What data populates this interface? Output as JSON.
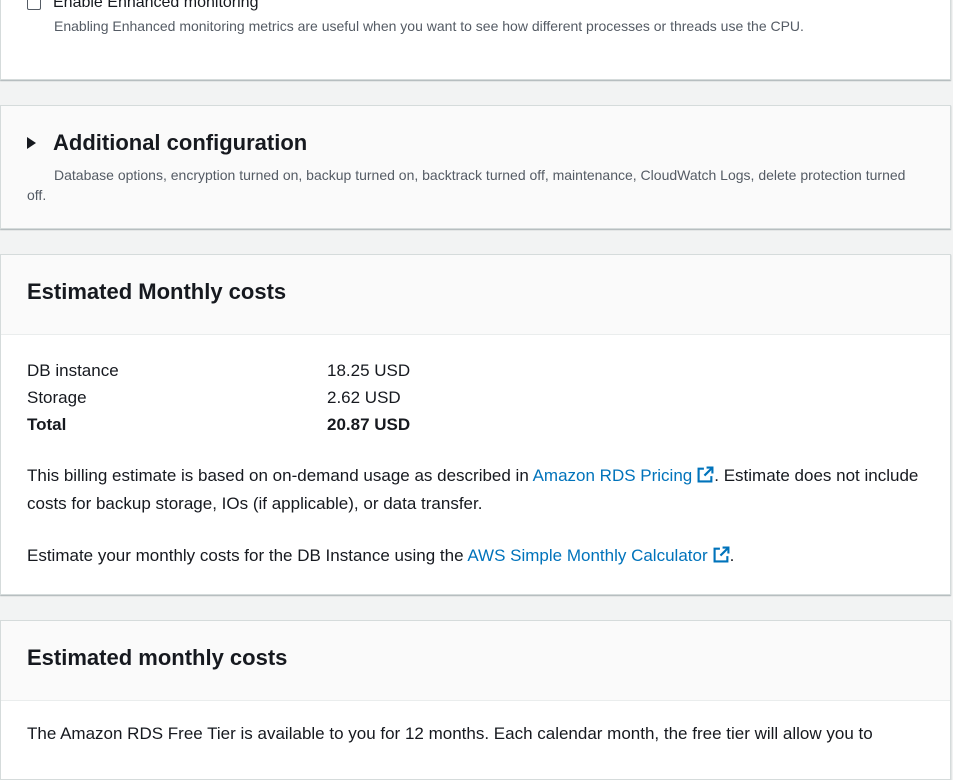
{
  "monitoring": {
    "checkbox_label": "Enable Enhanced monitoring",
    "helper": "Enabling Enhanced monitoring metrics are useful when you want to see how different processes or threads use the CPU."
  },
  "additional": {
    "title": "Additional configuration",
    "description": "Database options, encryption turned on, backup turned on, backtrack turned off, maintenance, CloudWatch Logs, delete protection turned off."
  },
  "costs": {
    "title": "Estimated Monthly costs",
    "rows": [
      {
        "label": "DB instance",
        "value": "18.25 USD"
      },
      {
        "label": "Storage",
        "value": "2.62 USD"
      },
      {
        "label": "Total",
        "value": "20.87 USD"
      }
    ],
    "billing_pre": "This billing estimate is based on on-demand usage as described in ",
    "billing_link": "Amazon RDS Pricing",
    "billing_post": ". Estimate does not include costs for backup storage, IOs (if applicable), or data transfer.",
    "calc_pre": "Estimate your monthly costs for the DB Instance using the ",
    "calc_link": "AWS Simple Monthly Calculator",
    "calc_post": "."
  },
  "freetier": {
    "title": "Estimated monthly costs",
    "text": "The Amazon RDS Free Tier is available to you for 12 months. Each calendar month, the free tier will allow you to"
  },
  "colors": {
    "link": "#0073bb",
    "background": "#f2f3f3"
  }
}
